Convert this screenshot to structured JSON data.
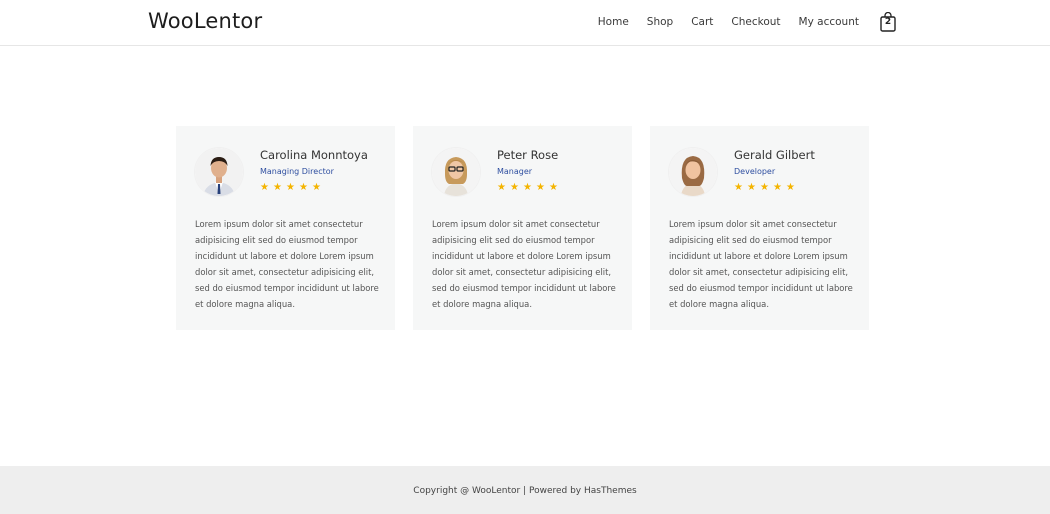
{
  "header": {
    "logo": "WooLentor",
    "nav": [
      "Home",
      "Shop",
      "Cart",
      "Checkout",
      "My account"
    ],
    "cart_count": "2"
  },
  "cards": [
    {
      "name": "Carolina Monntoya",
      "role": "Managing Director",
      "rating": 5,
      "text": "Lorem ipsum dolor sit amet consectetur adipisicing elit sed do eiusmod tempor incididunt ut labore et dolore Lorem ipsum dolor sit amet, consectetur adipisicing elit, sed do eiusmod tempor incididunt ut labore et dolore magna aliqua."
    },
    {
      "name": "Peter Rose",
      "role": "Manager",
      "rating": 5,
      "text": "Lorem ipsum dolor sit amet consectetur adipisicing elit sed do eiusmod tempor incididunt ut labore et dolore Lorem ipsum dolor sit amet, consectetur adipisicing elit, sed do eiusmod tempor incididunt ut labore et dolore magna aliqua."
    },
    {
      "name": "Gerald Gilbert",
      "role": "Developer",
      "rating": 5,
      "text": "Lorem ipsum dolor sit amet consectetur adipisicing elit sed do eiusmod tempor incididunt ut labore et dolore Lorem ipsum dolor sit amet, consectetur adipisicing elit, sed do eiusmod tempor incididunt ut labore et dolore magna aliqua."
    }
  ],
  "footer": {
    "text": "Copyright @ WooLentor | Powered by HasThemes"
  },
  "colors": {
    "star": "#f4b400",
    "role": "#2f4fa0",
    "card_bg": "#f6f7f7",
    "footer_bg": "#eeeeee"
  }
}
